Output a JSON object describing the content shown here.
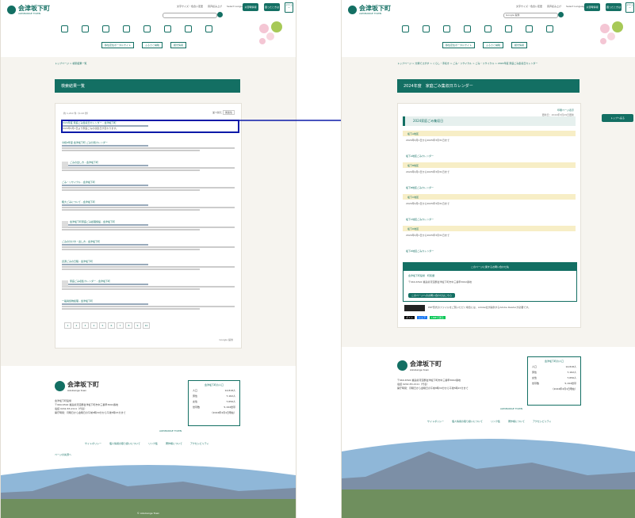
{
  "site": {
    "name": "会津坂下町",
    "name_en": "AIZUBANGE TOWN",
    "footer_name_en": "Aizubange town",
    "header_links": [
      "文字サイズ・色合い変更",
      "音声読み上げ",
      "Select Language"
    ],
    "header_buttons": [
      "災害時情報",
      "困ったときは"
    ],
    "menu_label": "メニュー",
    "search_placeholder": "Google 提供",
    "subnav": [
      "移住定住ポータルサイト",
      "ふるさと納税",
      "観光情報"
    ],
    "footer_address_label": "会津坂下町役場",
    "footer_address": "〒969-6592 福島県河沼郡会津坂下町市中三番甲3662番地",
    "footer_tel": "電話 0242-83-2111（代表）",
    "footer_hours": "開庁時間：月曜日から金曜日の午前8時30分から午後5時15分まで",
    "footer_links": [
      "サイトポリシー",
      "個人情報の取り扱いについて",
      "リンク集",
      "著作権について",
      "アクセシビリティ"
    ],
    "population": {
      "title": "会津坂下町の人口",
      "rows": [
        {
          "label": "人口",
          "value": "14,818人"
        },
        {
          "label": "男性",
          "value": "7,162人"
        },
        {
          "label": "女性",
          "value": "7,656人"
        },
        {
          "label": "世帯数",
          "value": "5,194世帯"
        }
      ],
      "date": "（2024年4月1日現在）",
      "town_label": "AIZUBANGE TOWN"
    },
    "copyright": "© Aizubange Town",
    "page_top": "ページの先頭へ"
  },
  "left_page": {
    "breadcrumb": [
      "トップページ",
      "検索結果一覧"
    ],
    "title": "検索結果一覧",
    "results_summary": "約 1,210 件（0.22 秒）",
    "sort_label": "並べ替え",
    "sort_value": "関連性",
    "results": [
      {
        "title": "2024年度 家庭ごみ集収日カレンダー - 会津坂下町",
        "snippet": "2024年4月1日より家庭ごみの収集日が変わります。"
      },
      {
        "title": "令和6年度 会津坂下町 ごみ分別カレンダー",
        "snippet": ""
      },
      {
        "title": "ごみの出し方 - 会津坂下町",
        "snippet": ""
      },
      {
        "title": "ごみ・リサイクル - 会津坂下町",
        "snippet": ""
      },
      {
        "title": "粗大ごみについて - 会津坂下町",
        "snippet": ""
      },
      {
        "title": "会津坂下町家庭ごみ処理施設 - 会津坂下町",
        "snippet": ""
      },
      {
        "title": "ごみの分け方・出し方 - 会津坂下町",
        "snippet": ""
      },
      {
        "title": "資源ごみの日程 - 会津坂下町",
        "snippet": ""
      },
      {
        "title": "家庭ごみ収集カレンダー - 会津坂下町",
        "snippet": ""
      },
      {
        "title": "一般廃棄物処理 - 会津坂下町",
        "snippet": ""
      }
    ],
    "pages": [
      "1",
      "2",
      "3",
      "4",
      "5",
      "6",
      "7",
      "8",
      "9",
      "10"
    ],
    "brand": "Google 提供"
  },
  "right_page": {
    "breadcrumb": [
      "トップページ",
      "分類でさがす",
      "くらし・手続き",
      "ごみ・リサイクル",
      "ごみ・リサイクル",
      "2024年度 家庭ごみ集収日カレンダー"
    ],
    "title": "2024年度　家庭ごみ集収日カレンダー",
    "update": "更新日：2024年3月29日更新",
    "print": "印刷ページ表示",
    "calendar_heading": "2024家庭ごみ集収日",
    "districts": [
      {
        "name": "坂下A地区",
        "info": "2024年4月1日から2025年3月31日まで",
        "link": "坂下A地区ごみカレンダー"
      },
      {
        "name": "坂下B地区",
        "info": "2024年4月1日から2025年3月31日まで",
        "link": "坂下B地区ごみカレンダー"
      },
      {
        "name": "坂下C地区",
        "info": "2024年4月1日から2025年3月31日まで",
        "link": "坂下C地区ごみカレンダー"
      },
      {
        "name": "坂下D地区",
        "info": "2024年4月1日から2025年3月31日まで",
        "link": "坂下D地区ごみカレンダー"
      }
    ],
    "inquiry_title": "このページに関するお問い合わせ先",
    "inquiry_dept": "会津坂下町役場　町民課",
    "inquiry_button": "このページへのお問い合わせはこちら",
    "pdf_note": "PDF形式のファイルをご覧いただく場合には、Adobe社が提供するAdobe Readerが必要です。",
    "side_button": "トップへ戻る",
    "social": [
      "ポスト",
      "シェア",
      "LINEで送る"
    ]
  },
  "colors": {
    "brand": "#136f63",
    "highlight": "#0b1aa8",
    "district_bg": "#f7eec6"
  }
}
